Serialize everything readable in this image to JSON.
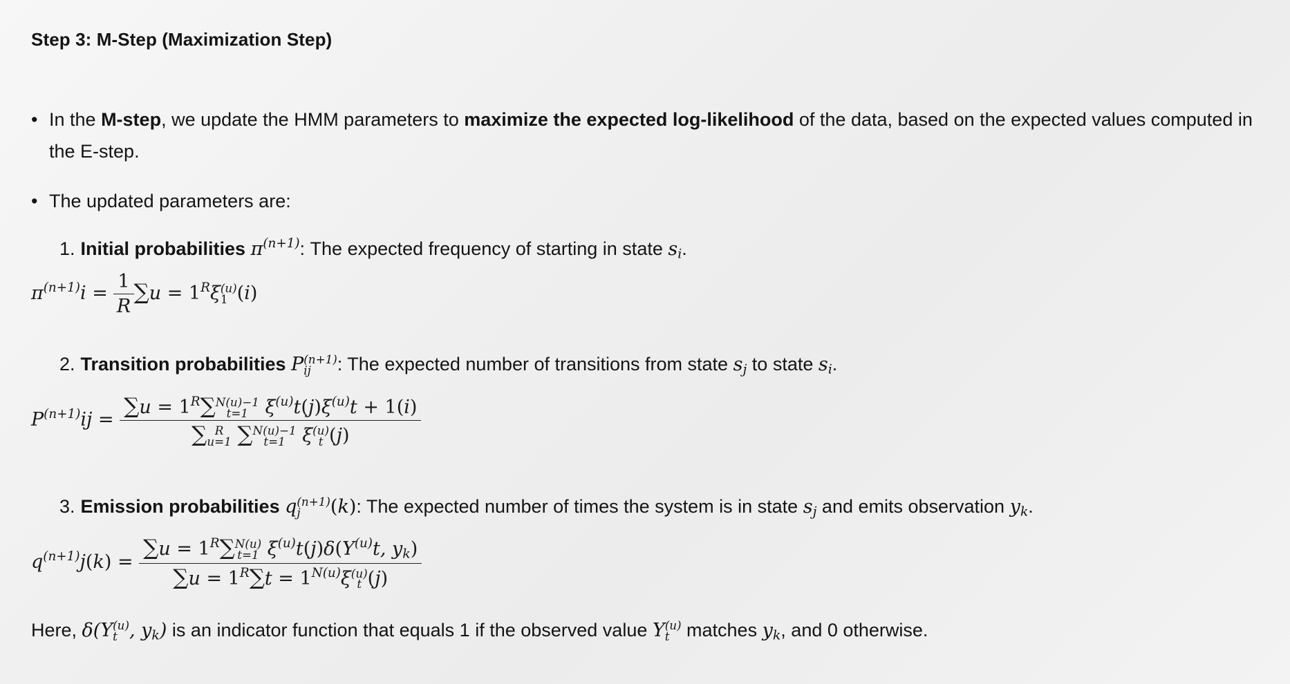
{
  "heading": "Step 3: M-Step (Maximization Step)",
  "bullets": {
    "b1_pre": "In the ",
    "b1_bold1": "M-step",
    "b1_mid": ", we update the HMM parameters to ",
    "b1_bold2": "maximize the expected log-likelihood",
    "b1_post": " of the data, based on the expected values computed in the E-step.",
    "b2": "The updated parameters are:"
  },
  "items": {
    "i1_num": "1.",
    "i1_bold": "Initial probabilities",
    "i1_text": ": The expected frequency of starting in state ",
    "i2_num": "2.",
    "i2_bold": "Transition probabilities",
    "i2_text": ": The expected number of transitions from state ",
    "i2_mid": " to state ",
    "i3_num": "3.",
    "i3_bold": "Emission probabilities",
    "i3_text": ": The expected number of times the system is in state ",
    "i3_mid": " and emits observation "
  },
  "footer": {
    "pre": "Here, ",
    "mid": " is an indicator function that equals 1 if the observed value ",
    "mid2": " matches ",
    "post": ", and 0 otherwise."
  },
  "dot": "."
}
